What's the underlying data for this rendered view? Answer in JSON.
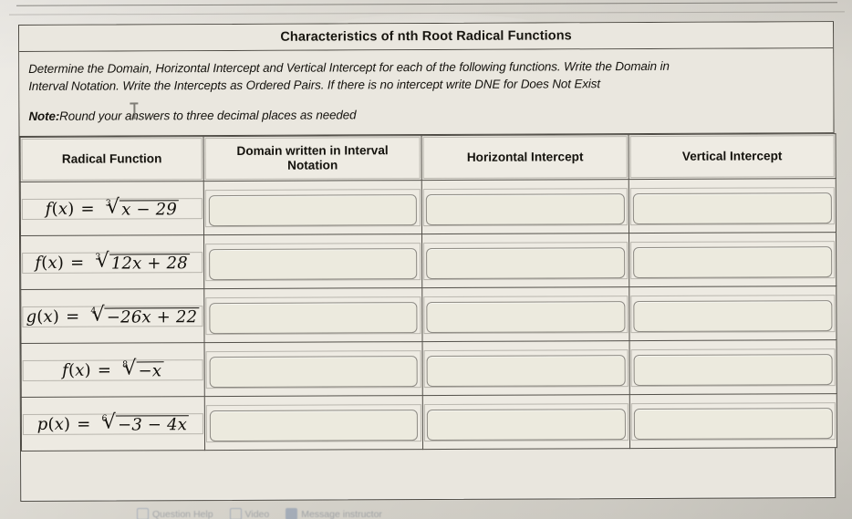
{
  "worksheet": {
    "title": "Characteristics of nth Root Radical Functions",
    "instructions_line1": "Determine the Domain, Horizontal Intercept and Vertical Intercept for each of the following functions. Write the Domain in",
    "instructions_line2": "Interval Notation. Write the Intercepts as Ordered Pairs. If there is no intercept write DNE for Does Not Exist",
    "note_label": "Note:",
    "note_text": "Round your answers to three decimal places as needed"
  },
  "table": {
    "headers": [
      "Radical Function",
      "Domain written in Interval Notation",
      "Horizontal Intercept",
      "Vertical Intercept"
    ],
    "rows": [
      {
        "name": "f",
        "arg": "x",
        "index": "3",
        "radicand": "x − 29",
        "domain_value": "",
        "horizontal_intercept_value": "",
        "vertical_intercept_value": ""
      },
      {
        "name": "f",
        "arg": "x",
        "index": "3",
        "radicand": "12x + 28",
        "domain_value": "",
        "horizontal_intercept_value": "",
        "vertical_intercept_value": ""
      },
      {
        "name": "g",
        "arg": "x",
        "index": "4",
        "radicand": "−26x + 22",
        "domain_value": "",
        "horizontal_intercept_value": "",
        "vertical_intercept_value": ""
      },
      {
        "name": "f",
        "arg": "x",
        "index": "8",
        "radicand": "−x",
        "domain_value": "",
        "horizontal_intercept_value": "",
        "vertical_intercept_value": ""
      },
      {
        "name": "p",
        "arg": "x",
        "index": "6",
        "radicand": "−3 − 4x",
        "domain_value": "",
        "horizontal_intercept_value": "",
        "vertical_intercept_value": ""
      }
    ]
  },
  "footer": {
    "items": [
      {
        "icon": "checkbox-icon",
        "label": "Question Help"
      },
      {
        "icon": "video-icon",
        "label": "Video"
      },
      {
        "icon": "message-icon",
        "label": "Message instructor"
      }
    ]
  }
}
